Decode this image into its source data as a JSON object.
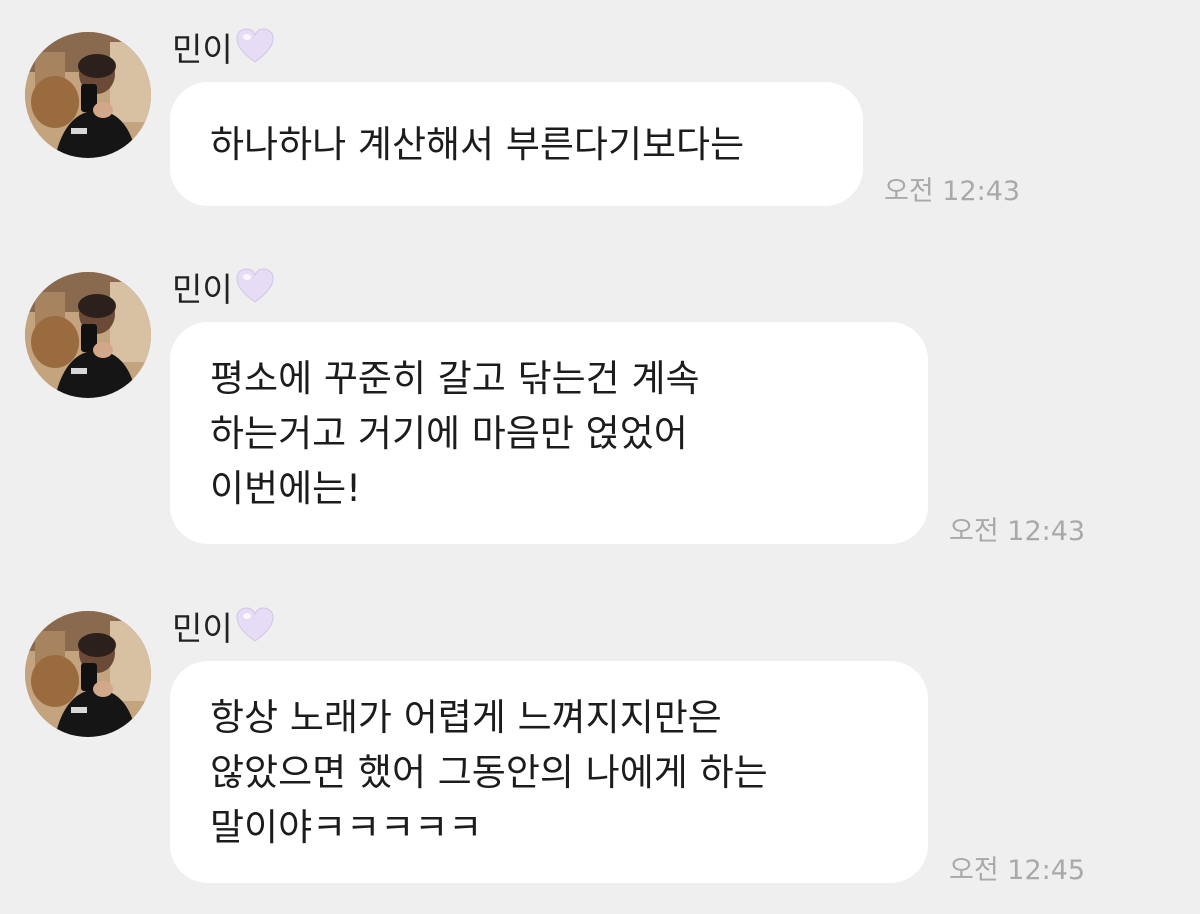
{
  "messages": [
    {
      "sender": "민이",
      "avatar_icon": "avatar-photo",
      "heart_icon": "lavender-heart",
      "lines": [
        "하나하나 계산해서 부른다기보다는"
      ],
      "time": "오전 12:43"
    },
    {
      "sender": "민이",
      "avatar_icon": "avatar-photo",
      "heart_icon": "lavender-heart",
      "lines": [
        "평소에 꾸준히 갈고 닦는건 계속",
        "하는거고 거기에 마음만 얹었어",
        "이번에는!"
      ],
      "time": "오전 12:43"
    },
    {
      "sender": "민이",
      "avatar_icon": "avatar-photo",
      "heart_icon": "lavender-heart",
      "lines": [
        "항상 노래가 어렵게 느껴지지만은",
        "않았으면 했어 그동안의 나에게 하는",
        "말이야ㅋㅋㅋㅋㅋ"
      ],
      "time": "오전 12:45"
    }
  ],
  "colors": {
    "background": "#efeff0",
    "bubble": "#ffffff",
    "time": "#a9a9ab",
    "heart": "#e6dcf5"
  }
}
